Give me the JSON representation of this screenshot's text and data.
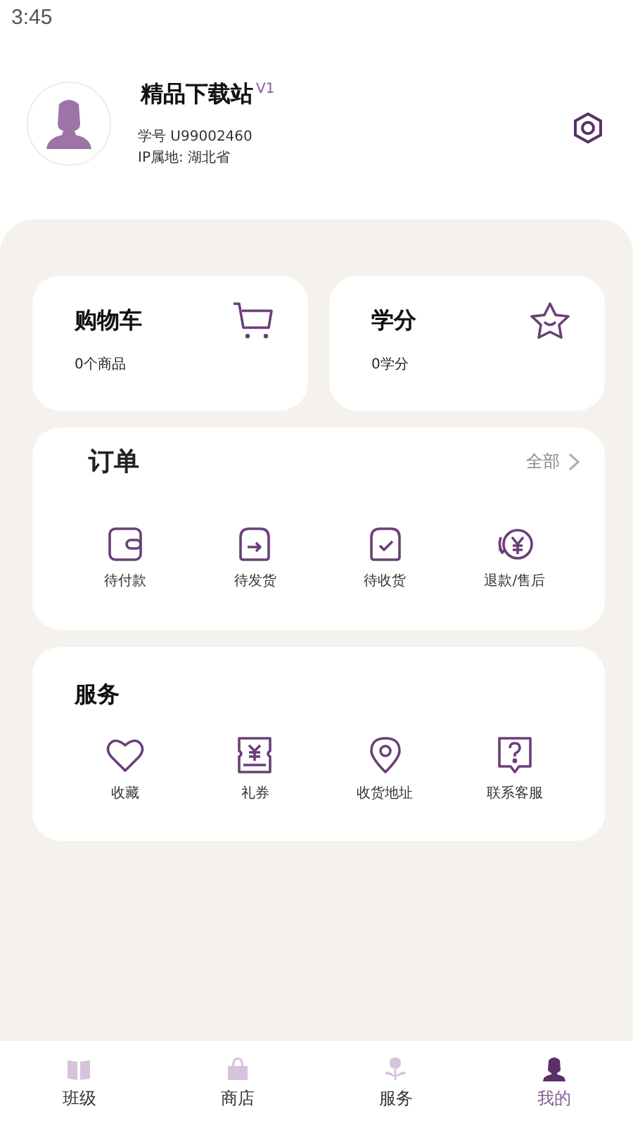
{
  "status_bar": {
    "time": "3:45"
  },
  "profile": {
    "name": "精品下载站",
    "level": "V1",
    "student_id": "学号  U99002460",
    "ip_location": "IP属地: 湖北省"
  },
  "summary_cards": [
    {
      "title": "购物车",
      "subtitle": "0个商品"
    },
    {
      "title": "学分",
      "subtitle": "0学分"
    }
  ],
  "orders": {
    "title": "订单",
    "all_link": "全部",
    "items": [
      {
        "label": "待付款"
      },
      {
        "label": "待发货"
      },
      {
        "label": "待收货"
      },
      {
        "label": "退款/售后"
      }
    ]
  },
  "services": {
    "title": "服务",
    "items": [
      {
        "label": "收藏"
      },
      {
        "label": "礼券"
      },
      {
        "label": "收货地址"
      },
      {
        "label": "联系客服"
      }
    ]
  },
  "tab_bar": [
    {
      "label": "班级",
      "selected": false
    },
    {
      "label": "商店",
      "selected": false
    },
    {
      "label": "服务",
      "selected": false
    },
    {
      "label": "我的",
      "selected": true
    }
  ]
}
